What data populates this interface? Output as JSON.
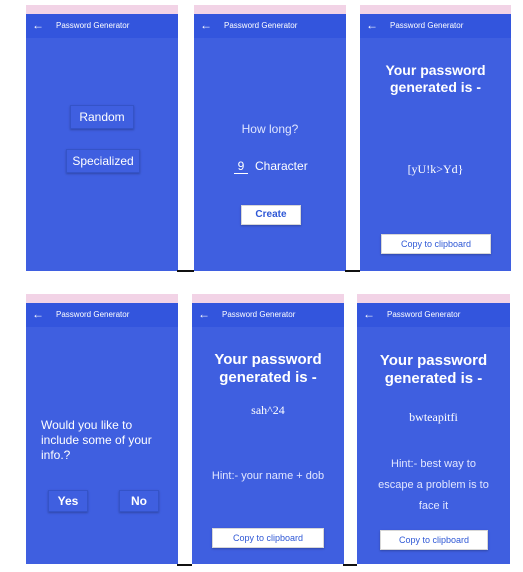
{
  "app_title": "Password Generator",
  "back_icon": "arrow-left-icon",
  "screens": {
    "s1": {
      "random_label": "Random",
      "specialized_label": "Specialized"
    },
    "s2": {
      "prompt": "How long?",
      "length_value": "9",
      "unit_label": "Character",
      "create_label": "Create"
    },
    "s3": {
      "heading_line1": "Your password",
      "heading_line2": "generated is -",
      "password": "[yU!k>Yd}",
      "copy_label": "Copy to clipboard"
    },
    "s4": {
      "question_line1": "Would you like to",
      "question_line2": "include some of your",
      "question_line3": "info.?",
      "yes_label": "Yes",
      "no_label": "No"
    },
    "s5": {
      "heading_line1": "Your password",
      "heading_line2": "generated is -",
      "password": "sah^24",
      "hint": "Hint:- your name + dob",
      "copy_label": "Copy to clipboard"
    },
    "s6": {
      "heading_line1": "Your password",
      "heading_line2": "generated is -",
      "password": "bwteapitfi",
      "hint_line1": "Hint:- best way to",
      "hint_line2": "escape a problem is to",
      "hint_line3": "face it",
      "copy_label": "Copy to clipboard"
    }
  },
  "colors": {
    "screen_bg": "#3f5fe0",
    "appbar": "#3355dd",
    "status_bar": "#f2d3e6",
    "button_text_blue": "#2f58d6"
  }
}
